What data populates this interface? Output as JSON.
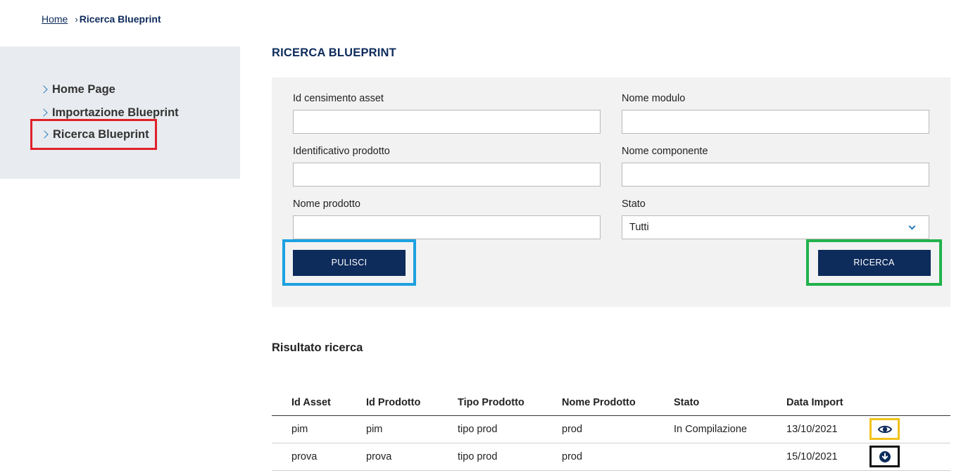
{
  "breadcrumb": {
    "home": "Home",
    "separator": "›",
    "current": "Ricerca Blueprint"
  },
  "sidebar": {
    "items": [
      {
        "label": "Home Page"
      },
      {
        "label": "Importazione Blueprint"
      },
      {
        "label": "Ricerca Blueprint"
      }
    ]
  },
  "main": {
    "title": "RICERCA BLUEPRINT",
    "form": {
      "id_censimento_asset": {
        "label": "Id censimento asset",
        "value": ""
      },
      "nome_modulo": {
        "label": "Nome modulo",
        "value": ""
      },
      "identificativo_prodotto": {
        "label": "Identificativo prodotto",
        "value": ""
      },
      "nome_componente": {
        "label": "Nome componente",
        "value": ""
      },
      "nome_prodotto": {
        "label": "Nome prodotto",
        "value": ""
      },
      "stato": {
        "label": "Stato",
        "selected": "Tutti"
      },
      "pulisci_label": "PULISCI",
      "ricerca_label": "RICERCA"
    },
    "results": {
      "title": "Risultato ricerca",
      "columns": [
        "Id Asset",
        "Id Prodotto",
        "Tipo Prodotto",
        "Nome Prodotto",
        "Stato",
        "Data Import"
      ],
      "rows": [
        {
          "id_asset": "pim",
          "id_prodotto": "pim",
          "tipo_prodotto": "tipo prod",
          "nome_prodotto": "prod",
          "stato": "In Compilazione",
          "data_import": "13/10/2021",
          "action_icon": "eye-icon"
        },
        {
          "id_asset": "prova",
          "id_prodotto": "prova",
          "tipo_prodotto": "tipo prod",
          "nome_prodotto": "prod",
          "stato": "",
          "data_import": "15/10/2021",
          "action_icon": "download-circle-icon"
        }
      ]
    }
  },
  "colors": {
    "primary": "#0d2b5b",
    "accent_chevron": "#2a7fc1",
    "highlight_red": "#e0212b",
    "highlight_blue": "#1da1e0",
    "highlight_green": "#22b24c",
    "highlight_yellow": "#f2c21b"
  }
}
